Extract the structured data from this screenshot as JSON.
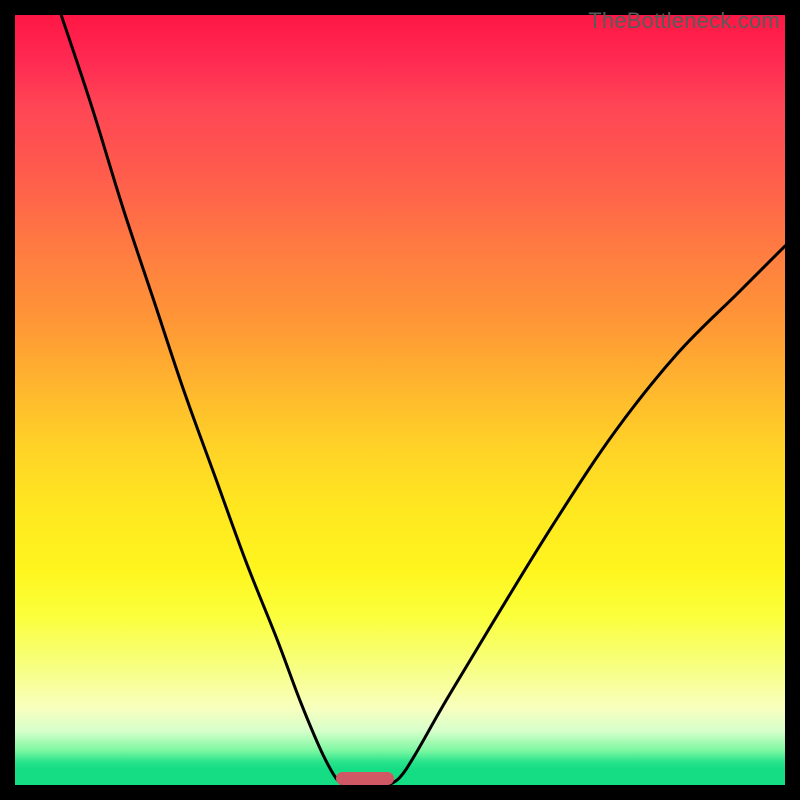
{
  "watermark": "TheBottleneck.com",
  "chart_data": {
    "type": "line",
    "title": "",
    "xlabel": "",
    "ylabel": "",
    "xlim": [
      0,
      100
    ],
    "ylim": [
      0,
      100
    ],
    "grid": false,
    "legend": false,
    "series": [
      {
        "name": "left-branch",
        "x": [
          6,
          10,
          14,
          18,
          22,
          26,
          30,
          34,
          37,
          39.5,
          41,
          42,
          42.8
        ],
        "y": [
          100,
          88,
          75,
          63,
          51,
          40,
          29,
          19,
          11,
          5,
          2,
          0.5,
          0
        ]
      },
      {
        "name": "right-branch",
        "x": [
          48.5,
          50,
          52,
          56,
          62,
          70,
          78,
          86,
          94,
          100
        ],
        "y": [
          0,
          1,
          4,
          11,
          21,
          34,
          46,
          56,
          64,
          70
        ]
      }
    ],
    "marker": {
      "x_center": 45.5,
      "y": 0,
      "width_pct": 7.5
    },
    "gradient_stops": [
      {
        "pos": 0.0,
        "color": "#ff1744"
      },
      {
        "pos": 0.5,
        "color": "#ffc828"
      },
      {
        "pos": 0.8,
        "color": "#fcff55"
      },
      {
        "pos": 0.97,
        "color": "#14dd83"
      },
      {
        "pos": 1.0,
        "color": "#14dd83"
      }
    ]
  }
}
